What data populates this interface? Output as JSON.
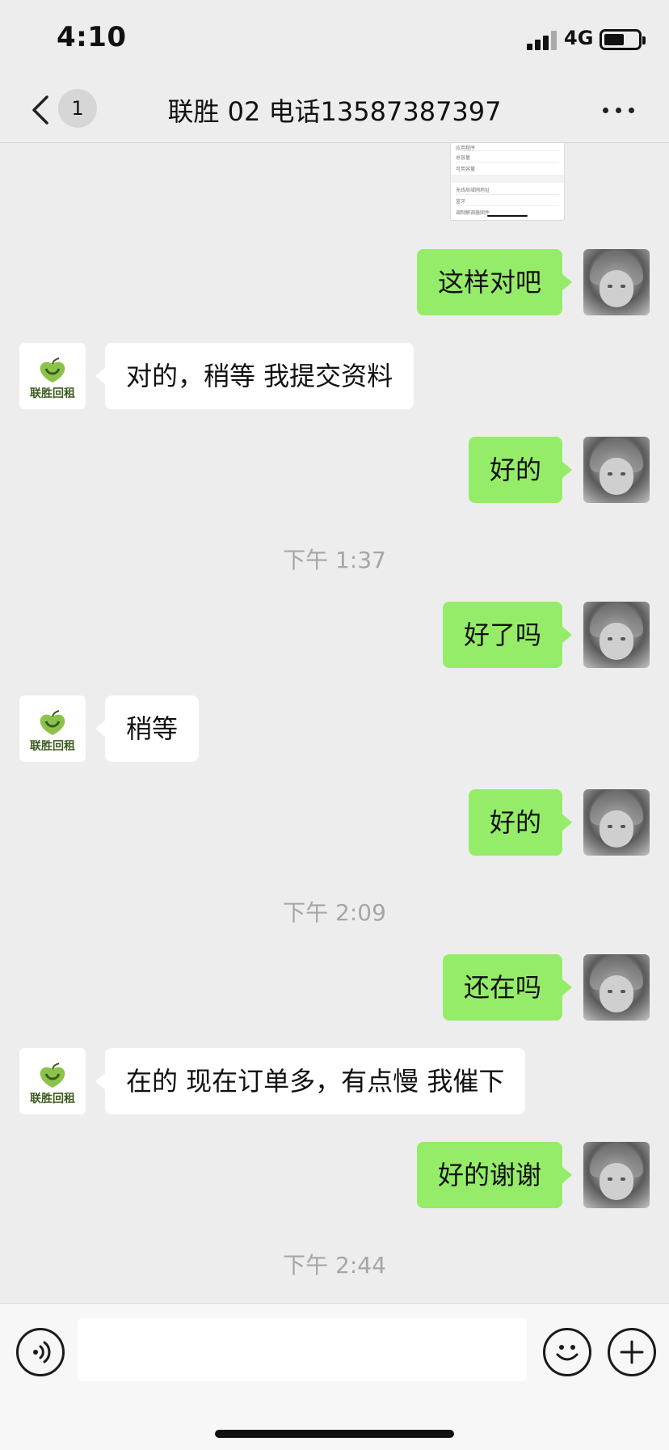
{
  "status_bar": {
    "time": "4:10",
    "network": "4G",
    "battery_level": 0.6
  },
  "header": {
    "back_badge": "1",
    "title": "联胜 02 电话13587387397"
  },
  "contact": {
    "logo_text": "联胜回租"
  },
  "shared_image_rows": [
    "应用程序",
    "总容量",
    "可用容量",
    "无线局域网地址",
    "蓝牙",
    "调制解调器固件"
  ],
  "messages": [
    {
      "side": "right",
      "text": "这样对吧"
    },
    {
      "side": "left",
      "text": "对的，稍等 我提交资料"
    },
    {
      "side": "right",
      "text": "好的"
    },
    {
      "type": "time",
      "text": "下午 1:37"
    },
    {
      "side": "right",
      "text": "好了吗"
    },
    {
      "side": "left",
      "text": "稍等"
    },
    {
      "side": "right",
      "text": "好的"
    },
    {
      "type": "time",
      "text": "下午 2:09"
    },
    {
      "side": "right",
      "text": "还在吗"
    },
    {
      "side": "left",
      "text": "在的  现在订单多，有点慢 我催下"
    },
    {
      "side": "right",
      "text": "好的谢谢"
    },
    {
      "type": "time",
      "text": "下午 2:44"
    }
  ]
}
